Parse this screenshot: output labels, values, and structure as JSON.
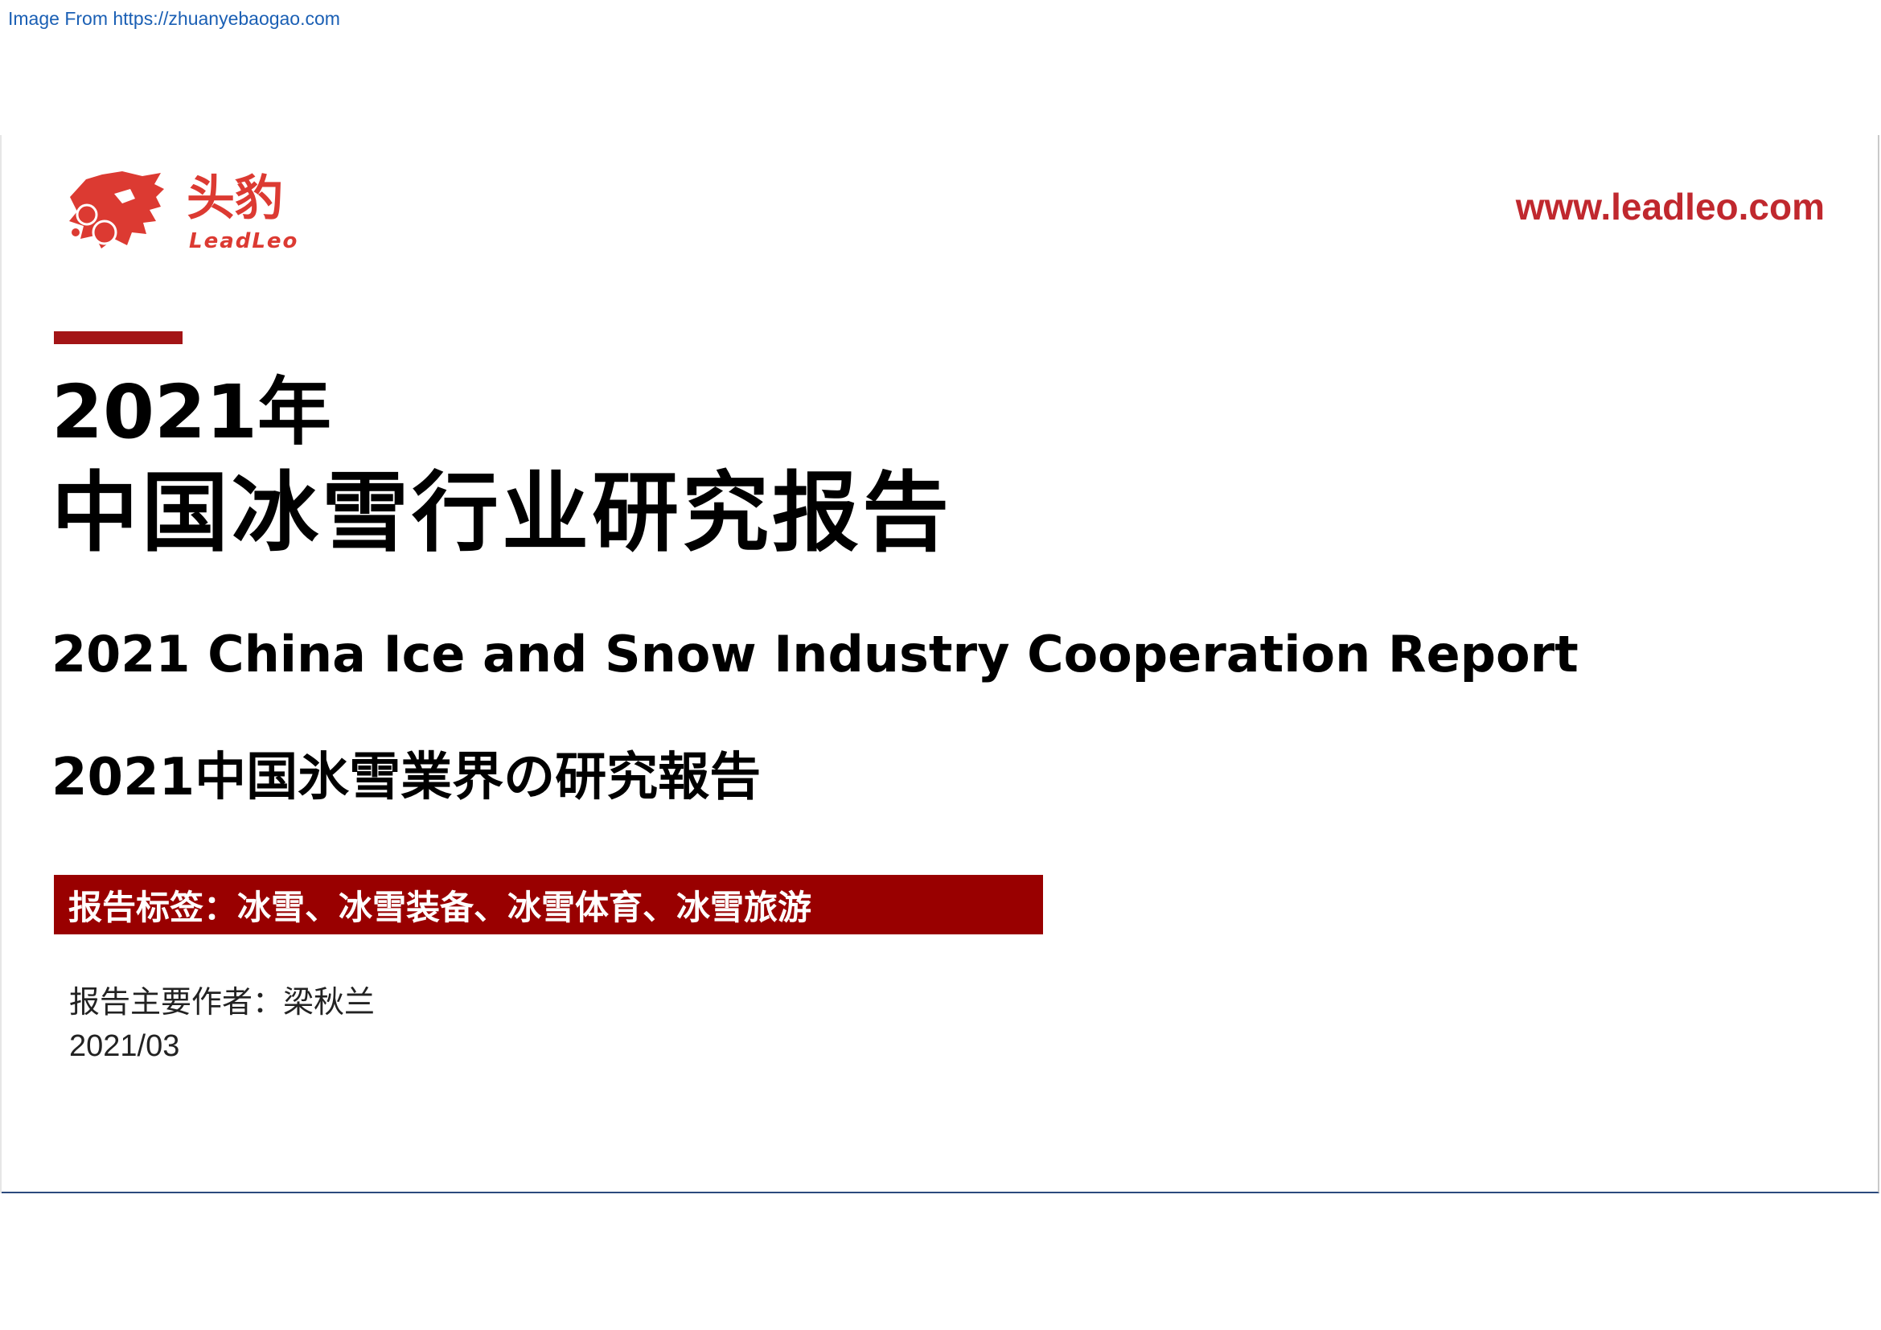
{
  "source_link": "Image From https://zhuanyebaogao.com",
  "logo": {
    "name_cn": "头豹",
    "name_en": "LeadLeo",
    "brand_color": "#dc3a32"
  },
  "site_url": "www.leadleo.com",
  "title": {
    "year": "2021年",
    "main_cn": "中国冰雪行业研究报告",
    "english": "2021 China Ice and Snow Industry Cooperation Report",
    "japanese": "2021中国氷雪業界の研究報告"
  },
  "tags_banner": "报告标签：冰雪、冰雪装备、冰雪体育、冰雪旅游",
  "author_line": "报告主要作者：梁秋兰",
  "date": "2021/03",
  "colors": {
    "accent_dark_red": "#990000",
    "url_red": "#c0282e",
    "link_blue": "#1a5fb4"
  }
}
